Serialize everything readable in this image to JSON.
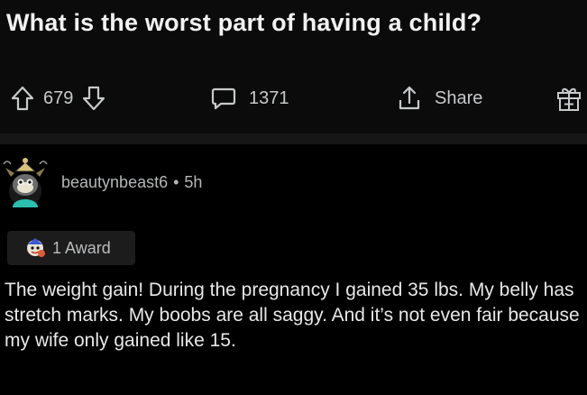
{
  "post": {
    "title": "What is the worst part of having a child?",
    "vote_count": "679",
    "comment_count": "1371",
    "share_label": "Share"
  },
  "comment": {
    "username": "beautynbeast6",
    "separator": "•",
    "age": "5h",
    "award_label": "1 Award",
    "body": "The weight gain! During the pregnancy I gained 35 lbs. My belly has stretch marks. My boobs are all saggy. And it’s not even fair because my wife only gained like 15."
  },
  "icons": {
    "upvote": "arrow-up-icon",
    "downvote": "arrow-down-icon",
    "comments": "speech-bubble-icon",
    "share": "share-icon",
    "gift": "gift-icon",
    "award": "award-icon",
    "avatar": "snoo-avatar-icon"
  },
  "colors": {
    "background": "#000000",
    "header_background": "#0b0b0b",
    "text": "#e8e8e8",
    "muted_text": "#b4b6b8",
    "avatar_teal": "#2bbfae"
  }
}
